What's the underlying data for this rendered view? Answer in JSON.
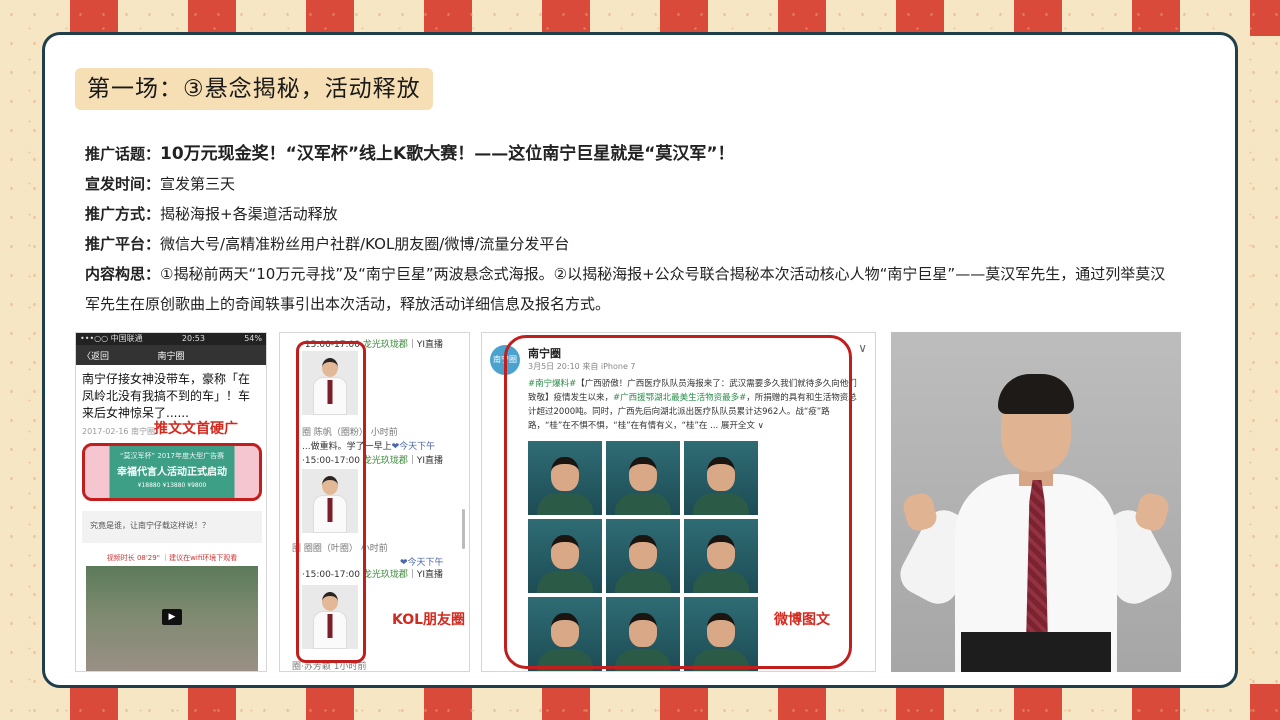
{
  "theme": {
    "accent_red": "#d32a1f",
    "border_navy": "#1f3f4d",
    "title_bg": "#f6dfb4"
  },
  "section_title": "第一场：③悬念揭秘，活动释放",
  "info": {
    "topic": {
      "label": "推广话题：",
      "value": "10万元现金奖！“汉军杯”线上K歌大赛！——这位南宁巨星就是“莫汉军”！"
    },
    "time": {
      "label": "宣发时间：",
      "value": "宣发第三天"
    },
    "method": {
      "label": "推广方式：",
      "value": "揭秘海报+各渠道活动释放"
    },
    "platform": {
      "label": "推广平台：",
      "value": "微信大号/高精准粉丝用户社群/KOL朋友圈/微博/流量分发平台"
    },
    "concept": {
      "label": "内容构思：",
      "value": "①揭秘前两天“10万元寻找”及“南宁巨星”两波悬念式海报。②以揭秘海报+公众号联合揭秘本次活动核心人物“南宁巨星”——莫汉军先生，通过列举莫汉军先生在原创歌曲上的奇闻轶事引出本次活动，释放活动详细信息及报名方式。"
    }
  },
  "wechat_article": {
    "status_left": "•••○○ 中国联通",
    "status_time": "20:53",
    "status_right": "54%",
    "back_label": "〈返回",
    "nav_title": "南宁圈",
    "headline": "南宁仔接女神没带车，豪称「在凤岭北没有我搞不到的车」！车来后女神惊呆了......",
    "date": "2017-02-16 南宁圈",
    "ad_label": "推文文首硬广",
    "banner_top": "“莫汉军杯” 2017年度大型广告赛",
    "banner_main": "幸福代言人活动正式启动",
    "banner_prizes": "¥18880  ¥13880  ¥9800",
    "quote": "究竟是谁，让南宁仔载这样说！？",
    "video_meta": "视频时长 08'29\" ｜建议在wifi环境下观看"
  },
  "kol_moments": {
    "lines": [
      {
        "a": "·15:00-17:00 ",
        "g": "龙光玖珑郡",
        "b": "｜YI直播"
      },
      {
        "a": "圈 陈帆（圈粉）  小时前",
        "g": "",
        "b": ""
      },
      {
        "a": "...做重料。学了一早上",
        "g": "",
        "b": "❤今天下午"
      },
      {
        "a": "·15:00-17:00 ",
        "g": "龙光玖珑郡",
        "b": "｜YI直播"
      },
      {
        "a": "圈 圈圈（叶圈）   小时前",
        "g": "",
        "b": ""
      },
      {
        "a": "",
        "g": "",
        "b": "❤今天下午"
      },
      {
        "a": "·15:00-17:00 ",
        "g": "龙光玖珑郡",
        "b": "｜YI直播"
      },
      {
        "a": "圈·苏芳颖   1小时前",
        "g": "",
        "b": ""
      }
    ],
    "label": "KOL朋友圈"
  },
  "weibo": {
    "avatar_text": "南宁圈",
    "name": "南宁圈",
    "meta": "3月5日 20:10 来自 iPhone 7",
    "tag1": "#南宁爆料#",
    "tag2": "#广西援鄂湖北最美生活物资最多#",
    "text1": "【广西骄傲！广西医疗队队员海报来了：武汉需要多久我们就待多久",
    "text2": "向他们致敬】疫情发生以来，",
    "text3": "，所捐赠的具有和生活物资总计超过2000吨。同时，广西先后向湖北派出医疗队队员累计达962人。战“疫”路路，“桂”在不惧不惧，“桂”在有情有义，“桂”在 ... 展开全文 ∨",
    "label": "微博图文"
  },
  "icons": {
    "play": "play-icon",
    "chevron": "chevron-down-icon"
  }
}
